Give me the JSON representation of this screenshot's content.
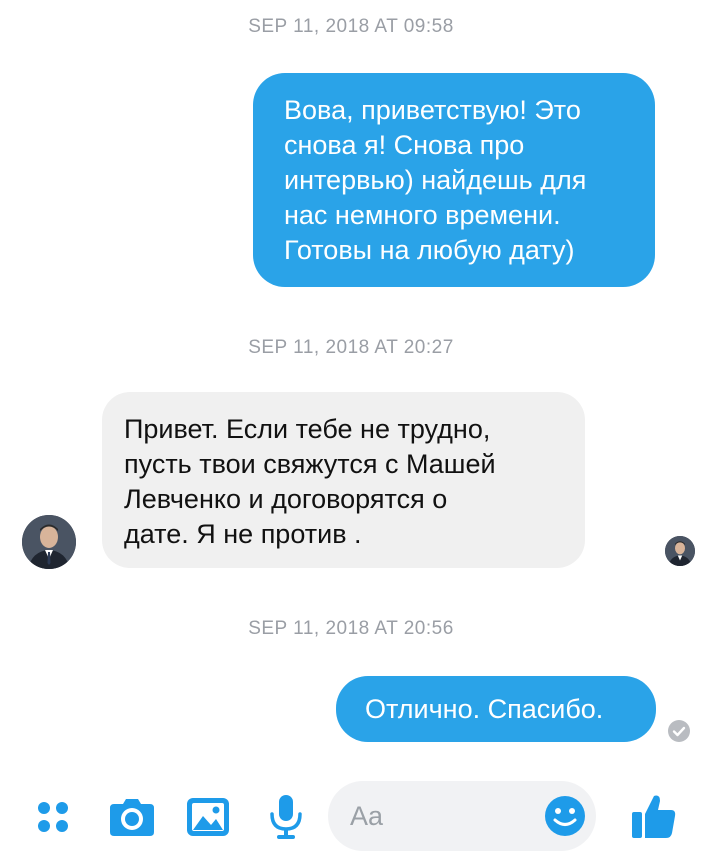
{
  "timestamps": [
    "SEP 11, 2018 AT 09:58",
    "SEP 11, 2018 AT 20:27",
    "SEP 11, 2018 AT 20:56"
  ],
  "messages": [
    {
      "direction": "outgoing",
      "lines": [
        "Вова, приветствую! Это",
        "снова я! Снова про",
        "интервью) найдешь для",
        "нас немного времени.",
        "Готовы на любую дату)"
      ]
    },
    {
      "direction": "incoming",
      "lines": [
        "Привет. Если тебе не трудно,",
        "пусть твои свяжутся с Машей",
        "Левченко и договорятся о",
        "дате. Я не против ."
      ]
    },
    {
      "direction": "outgoing",
      "lines": [
        "Отлично. Спасибо."
      ]
    }
  ],
  "composer": {
    "placeholder": "Aa",
    "icons": [
      "apps-icon",
      "camera-icon",
      "gallery-icon",
      "microphone-icon",
      "emoji-icon",
      "thumbs-up-icon"
    ]
  },
  "colors": {
    "outgoing_bubble": "#2aa3e8",
    "incoming_bubble": "#f0f0f0",
    "accent": "#1e9be9",
    "timestamp": "#9a9ea5"
  }
}
